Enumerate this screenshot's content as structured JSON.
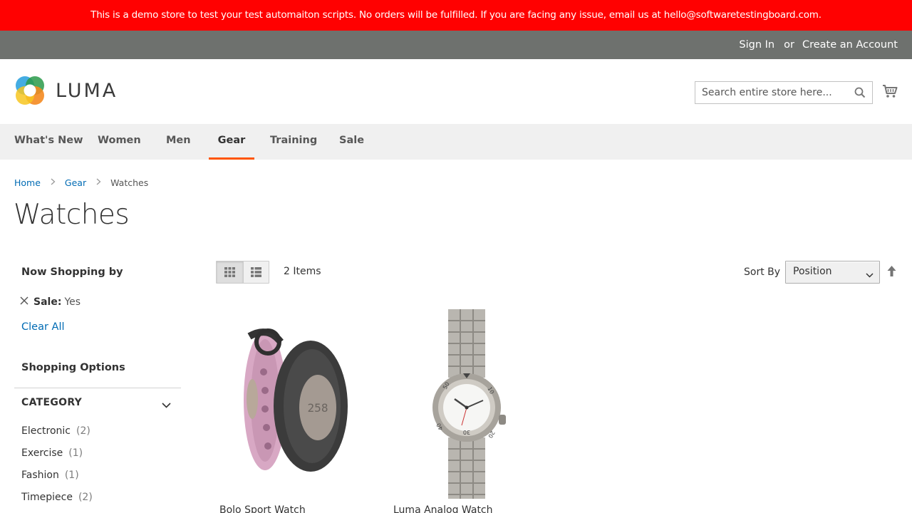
{
  "banner": {
    "text": "This is a demo store to test your test automaiton scripts. No orders will be fulfilled. If you are facing any issue, email us at hello@softwaretestingboard.com."
  },
  "header": {
    "sign_in": "Sign In",
    "or": "or",
    "create_account": "Create an Account"
  },
  "logo": {
    "text": "LUMA"
  },
  "search": {
    "placeholder": "Search entire store here..."
  },
  "nav": {
    "items": [
      {
        "label": "What's New"
      },
      {
        "label": "Women"
      },
      {
        "label": "Men"
      },
      {
        "label": "Gear",
        "active": true
      },
      {
        "label": "Training"
      },
      {
        "label": "Sale"
      }
    ]
  },
  "breadcrumb": {
    "home": "Home",
    "gear": "Gear",
    "current": "Watches"
  },
  "page": {
    "title": "Watches"
  },
  "filters": {
    "now_shopping_title": "Now Shopping by",
    "active": {
      "label": "Sale:",
      "value": "Yes"
    },
    "clear_all": "Clear All",
    "shopping_options_title": "Shopping Options",
    "category": {
      "title": "CATEGORY",
      "items": [
        {
          "name": "Electronic",
          "count": "(2)"
        },
        {
          "name": "Exercise",
          "count": "(1)"
        },
        {
          "name": "Fashion",
          "count": "(1)"
        },
        {
          "name": "Timepiece",
          "count": "(2)"
        }
      ]
    }
  },
  "toolbar": {
    "view_mode": "grid",
    "item_count": "2 Items",
    "sort_label": "Sort By",
    "sort_value": "Position"
  },
  "products": [
    {
      "name": "Bolo Sport Watch"
    },
    {
      "name": "Luma Analog Watch"
    }
  ],
  "colors": {
    "banner_bg": "#ff0101",
    "header_bg": "#6e716e",
    "nav_bg": "#f0f0f0",
    "nav_active_underline": "#ff5501",
    "link": "#006bb4"
  }
}
